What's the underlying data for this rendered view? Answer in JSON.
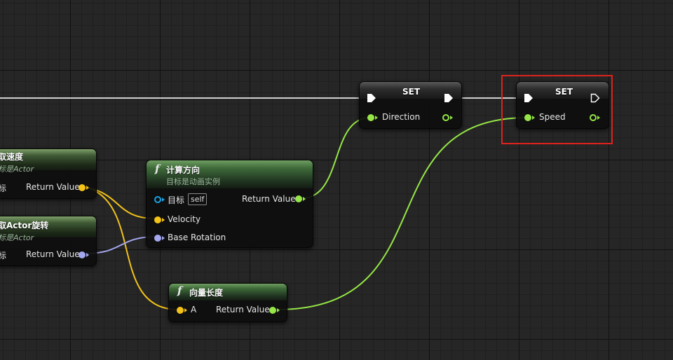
{
  "colors": {
    "exec": "#ffffff",
    "vector": "#f3c318",
    "float": "#95e646",
    "rotator": "#a4a8f0",
    "object": "#1aa3e6",
    "highlight": "#e0221c"
  },
  "nodes": {
    "get_velocity": {
      "title_partial": "取速度",
      "subtitle_partial": "标是Actor",
      "target_partial": "标",
      "output": "Return Value"
    },
    "get_rotation": {
      "title_partial": "取Actor旋转",
      "subtitle_partial": "标是Actor",
      "target_partial": "标",
      "output": "Return Value"
    },
    "calc_direction": {
      "icon": "function-icon",
      "title": "计算方向",
      "subtitle": "目标是动画实例",
      "target_label": "目标",
      "target_value": "self",
      "input_velocity": "Velocity",
      "input_rotation": "Base Rotation",
      "output": "Return Value"
    },
    "vector_length": {
      "icon": "function-icon",
      "title": "向量长度",
      "input": "A",
      "output": "Return Value"
    },
    "set_direction": {
      "title": "SET",
      "var": "Direction"
    },
    "set_speed": {
      "title": "SET",
      "var": "Speed"
    }
  }
}
